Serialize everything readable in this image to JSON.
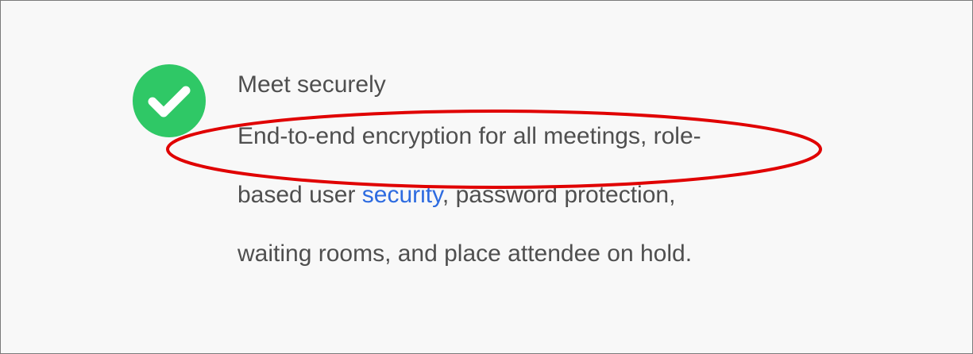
{
  "feature": {
    "title": "Meet securely",
    "description": {
      "line1": "End-to-end encryption for all meetings, role-",
      "line2_prefix": "based user ",
      "line2_link": "security",
      "line2_suffix": ", password protection,",
      "line3": "waiting rooms, and place attendee on hold."
    },
    "icon": "check-circle-icon"
  },
  "colors": {
    "icon_background": "#2fc866",
    "text": "#4f4f4f",
    "link": "#2d6be0",
    "annotation": "#e00000"
  }
}
